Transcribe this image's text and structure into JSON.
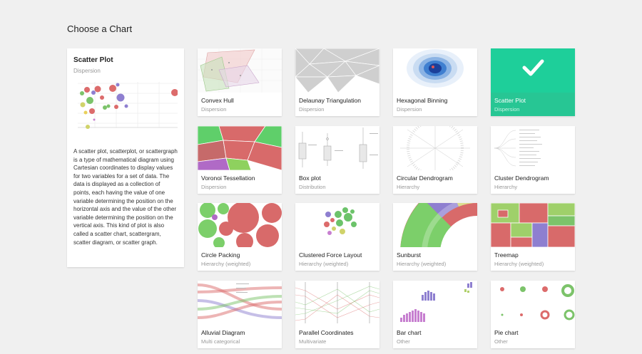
{
  "page": {
    "title": "Choose a Chart"
  },
  "selected": {
    "title": "Scatter Plot",
    "category": "Dispersion",
    "description": "A scatter plot, scatterplot, or scattergraph is a type of mathematical diagram using Cartesian coordinates to display values for two variables for a set of data. The data is displayed as a collection of points, each having the value of one variable determining the position on the horizontal axis and the value of the other variable determining the position on the vertical axis. This kind of plot is also called a scatter chart, scattergram, scatter diagram, or scatter graph."
  },
  "charts": [
    {
      "label": "Convex Hull",
      "category": "Dispersion",
      "icon": "convex-hull-thumbnail"
    },
    {
      "label": "Delaunay Triangulation",
      "category": "Dispersion",
      "icon": "delaunay-thumbnail"
    },
    {
      "label": "Hexagonal Binning",
      "category": "Dispersion",
      "icon": "hexbin-thumbnail"
    },
    {
      "label": "Scatter Plot",
      "category": "Dispersion",
      "icon": "checkmark-icon",
      "selected": true
    },
    {
      "label": "Voronoi Tessellation",
      "category": "Dispersion",
      "icon": "voronoi-thumbnail"
    },
    {
      "label": "Box plot",
      "category": "Distribution",
      "icon": "boxplot-thumbnail"
    },
    {
      "label": "Circular Dendrogram",
      "category": "Hierarchy",
      "icon": "circular-dendrogram-thumbnail"
    },
    {
      "label": "Cluster Dendrogram",
      "category": "Hierarchy",
      "icon": "cluster-dendrogram-thumbnail"
    },
    {
      "label": "Circle Packing",
      "category": "Hierarchy (weighted)",
      "icon": "circle-packing-thumbnail"
    },
    {
      "label": "Clustered Force Layout",
      "category": "Hierarchy (weighted)",
      "icon": "force-layout-thumbnail"
    },
    {
      "label": "Sunburst",
      "category": "Hierarchy (weighted)",
      "icon": "sunburst-thumbnail"
    },
    {
      "label": "Treemap",
      "category": "Hierarchy (weighted)",
      "icon": "treemap-thumbnail"
    },
    {
      "label": "Alluvial Diagram",
      "category": "Multi categorical",
      "icon": "alluvial-thumbnail"
    },
    {
      "label": "Parallel Coordinates",
      "category": "Multivariate",
      "icon": "parallel-coordinates-thumbnail"
    },
    {
      "label": "Bar chart",
      "category": "Other",
      "icon": "bar-chart-thumbnail"
    },
    {
      "label": "Pie chart",
      "category": "Other",
      "icon": "pie-chart-thumbnail"
    }
  ],
  "colors": {
    "accent": "#1ecf9a",
    "background": "#f0f0f0"
  }
}
